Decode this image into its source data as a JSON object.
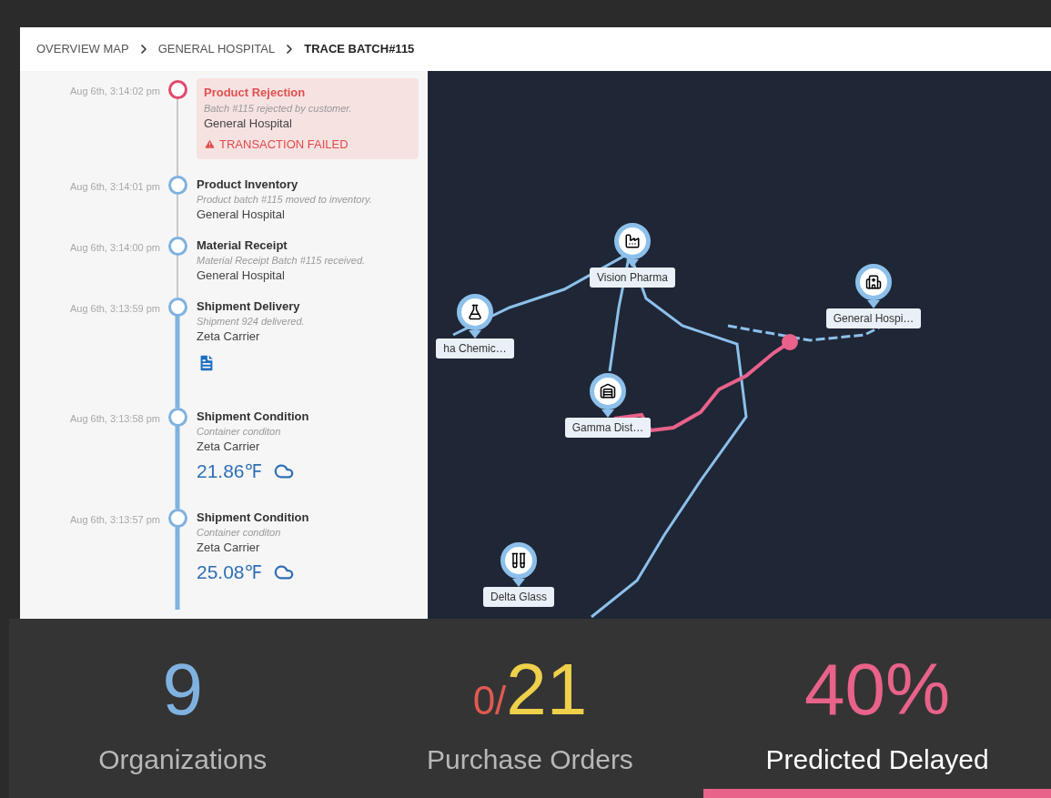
{
  "breadcrumb": [
    {
      "label": "OVERVIEW MAP",
      "selected": false
    },
    {
      "label": "GENERAL HOSPITAL",
      "selected": false
    },
    {
      "label": "TRACE BATCH#115",
      "selected": true
    }
  ],
  "timeline": [
    {
      "time": "Aug 6th, 3:14:02 pm",
      "title": "Product Rejection",
      "description": "Batch #115 rejected by customer.",
      "organization": "General Hospital",
      "failed": true,
      "alert": "TRANSACTION FAILED",
      "tracked": false,
      "document": false
    },
    {
      "time": "Aug 6th, 3:14:01 pm",
      "title": "Product Inventory",
      "description": "Product batch #115 moved to inventory.",
      "organization": "General Hospital",
      "failed": false,
      "tracked": false,
      "document": false
    },
    {
      "time": "Aug 6th, 3:14:00 pm",
      "title": "Material Receipt",
      "description": "Material Receipt Batch #115 received.",
      "organization": "General Hospital",
      "failed": false,
      "tracked": false,
      "document": false
    },
    {
      "time": "Aug 6th, 3:13:59 pm",
      "title": "Shipment Delivery",
      "description": "Shipment 924 delivered.",
      "organization": "Zeta Carrier",
      "failed": false,
      "tracked": true,
      "document": true
    },
    {
      "time": "Aug 6th, 3:13:58 pm",
      "title": "Shipment Condition",
      "description": "Container conditon",
      "organization": "Zeta Carrier",
      "failed": false,
      "tracked": true,
      "document": false,
      "reading": "21.86℉"
    },
    {
      "time": "Aug 6th, 3:13:57 pm",
      "title": "Shipment Condition",
      "description": "Container conditon",
      "organization": "Zeta Carrier",
      "failed": false,
      "tracked": true,
      "document": false,
      "reading": "25.08℉"
    }
  ],
  "map": {
    "markers": [
      {
        "label": "Vision Pharma",
        "kind": "factory"
      },
      {
        "label": "ha Chemic…",
        "kind": "lab"
      },
      {
        "label": "Gamma Dist…",
        "kind": "warehouse"
      },
      {
        "label": "General Hospi…",
        "kind": "hospital"
      },
      {
        "label": "Delta Glass",
        "kind": "glassware"
      }
    ]
  },
  "stats": [
    {
      "parts": [
        {
          "text": "9",
          "color": "#7fb2e0",
          "small": false
        }
      ],
      "label": "Organizations",
      "selected": false
    },
    {
      "parts": [
        {
          "text": "0/",
          "color": "#e05a52",
          "small": true
        },
        {
          "text": "21",
          "color": "#eed04a",
          "small": false
        }
      ],
      "label": "Purchase Orders",
      "selected": false
    },
    {
      "parts": [
        {
          "text": "40%",
          "color": "#e8628a",
          "small": false
        }
      ],
      "label": "Predicted Delayed",
      "selected": true
    }
  ]
}
